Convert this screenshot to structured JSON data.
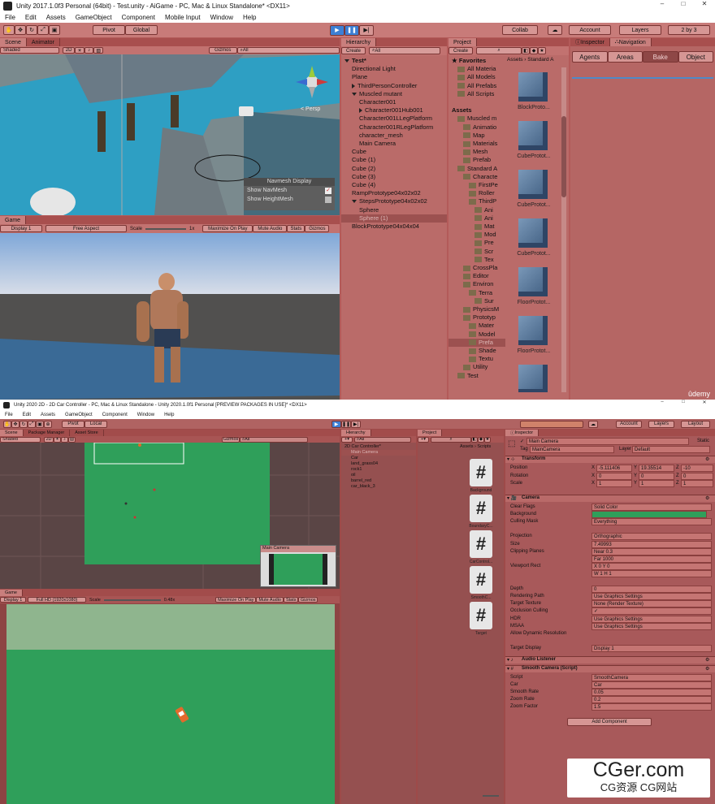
{
  "top": {
    "title": "Unity 2017.1.0f3 Personal (64bit) - Test.unity - AiGame - PC, Mac & Linux Standalone* <DX11>",
    "menu": [
      "File",
      "Edit",
      "Assets",
      "GameObject",
      "Component",
      "Mobile Input",
      "Window",
      "Help"
    ],
    "toolbar": {
      "pivot": "Pivot",
      "global": "Global",
      "collab": "Collab",
      "account": "Account",
      "layers": "Layers",
      "layout": "2 by 3"
    },
    "scene": {
      "tab": "Scene",
      "tab2": "Animator",
      "shading": "Shaded",
      "mode2d": "2D",
      "gizmos": "Gizmos",
      "search": "All",
      "persp": "< Persp",
      "navmesh": {
        "title": "Navmesh Display",
        "show_navmesh": "Show NavMesh",
        "show_height": "Show HeightMesh"
      }
    },
    "game": {
      "tab": "Game",
      "display": "Display 1",
      "aspect": "Free Aspect",
      "scale_label": "Scale",
      "scale_value": "1x",
      "maximize": "Maximize On Play",
      "mute": "Mute Audio",
      "stats": "Stats",
      "gizmos": "Gizmos"
    },
    "hierarchy": {
      "tab": "Hierarchy",
      "create": "Create",
      "search": "All",
      "items": [
        {
          "label": "Test*",
          "indent": 0,
          "arrow": "down",
          "bold": true
        },
        {
          "label": "Directional Light",
          "indent": 1
        },
        {
          "label": "Plane",
          "indent": 1
        },
        {
          "label": "ThirdPersonController",
          "indent": 1,
          "arrow": "right"
        },
        {
          "label": "Muscled mutant",
          "indent": 1,
          "arrow": "down"
        },
        {
          "label": "Character001",
          "indent": 2
        },
        {
          "label": "Character001Hub001",
          "indent": 2,
          "arrow": "right"
        },
        {
          "label": "Character001LLegPlatform",
          "indent": 2
        },
        {
          "label": "Character001RLegPlatform",
          "indent": 2
        },
        {
          "label": "character_mesh",
          "indent": 2
        },
        {
          "label": "Main Camera",
          "indent": 2
        },
        {
          "label": "Cube",
          "indent": 1
        },
        {
          "label": "Cube (1)",
          "indent": 1
        },
        {
          "label": "Cube (2)",
          "indent": 1
        },
        {
          "label": "Cube (3)",
          "indent": 1
        },
        {
          "label": "Cube (4)",
          "indent": 1
        },
        {
          "label": "RampPrototype04x02x02",
          "indent": 1
        },
        {
          "label": "StepsPrototype04x02x02",
          "indent": 1,
          "arrow": "down"
        },
        {
          "label": "Sphere",
          "indent": 2
        },
        {
          "label": "Sphere (1)",
          "indent": 2,
          "selected": true
        },
        {
          "label": "BlockPrototype04x04x04",
          "indent": 1
        }
      ]
    },
    "project": {
      "tab": "Project",
      "create": "Create",
      "breadcrumb": "Assets › Standard A",
      "tree": [
        {
          "label": "Favorites",
          "indent": 0,
          "bold": true,
          "star": true
        },
        {
          "label": "All Materia",
          "indent": 1
        },
        {
          "label": "All Models",
          "indent": 1
        },
        {
          "label": "All Prefabs",
          "indent": 1
        },
        {
          "label": "All Scripts",
          "indent": 1
        },
        {
          "label": "",
          "indent": 0
        },
        {
          "label": "Assets",
          "indent": 0,
          "bold": true
        },
        {
          "label": "Muscled m",
          "indent": 1
        },
        {
          "label": "Animatio",
          "indent": 2
        },
        {
          "label": "Map",
          "indent": 2
        },
        {
          "label": "Materials",
          "indent": 2
        },
        {
          "label": "Mesh",
          "indent": 2
        },
        {
          "label": "Prefab",
          "indent": 2
        },
        {
          "label": "Standard A",
          "indent": 1
        },
        {
          "label": "Characte",
          "indent": 2
        },
        {
          "label": "FirstPe",
          "indent": 3
        },
        {
          "label": "Roller",
          "indent": 3
        },
        {
          "label": "ThirdP",
          "indent": 3
        },
        {
          "label": "Ani",
          "indent": 4
        },
        {
          "label": "Ani",
          "indent": 4
        },
        {
          "label": "Mat",
          "indent": 4
        },
        {
          "label": "Mod",
          "indent": 4
        },
        {
          "label": "Pre",
          "indent": 4
        },
        {
          "label": "Scr",
          "indent": 4
        },
        {
          "label": "Tex",
          "indent": 4
        },
        {
          "label": "CrossPla",
          "indent": 2
        },
        {
          "label": "Editor",
          "indent": 2
        },
        {
          "label": "Environ",
          "indent": 2
        },
        {
          "label": "Terra",
          "indent": 3
        },
        {
          "label": "Sur",
          "indent": 4
        },
        {
          "label": "PhysicsM",
          "indent": 2
        },
        {
          "label": "Prototyp",
          "indent": 2
        },
        {
          "label": "Mater",
          "indent": 3
        },
        {
          "label": "Model",
          "indent": 3
        },
        {
          "label": "Prefa",
          "indent": 3,
          "selected": true
        },
        {
          "label": "Shade",
          "indent": 3
        },
        {
          "label": "Textu",
          "indent": 3
        },
        {
          "label": "Utility",
          "indent": 2
        },
        {
          "label": "Test",
          "indent": 1
        }
      ],
      "assets": [
        "BlockProto...",
        "CubeProtot...",
        "CubeProtot...",
        "CubeProtot...",
        "FloorProtot...",
        "FloorProtot...",
        ""
      ]
    },
    "inspector": {
      "tab": "Inspector",
      "tab2": "Navigation",
      "buttons": [
        "Agents",
        "Areas",
        "Bake",
        "Object"
      ],
      "active": "Bake"
    },
    "watermark": "ûdemy"
  },
  "bottom": {
    "title": "Unity 2020 2D - 2D Car Controller - PC, Mac & Linux Standalone - Unity 2020.1.0f1 Personal [PREVIEW PACKAGES IN USE]* <DX11>",
    "menu": [
      "File",
      "Edit",
      "Assets",
      "GameObject",
      "Component",
      "Window",
      "Help"
    ],
    "toolbar": {
      "pivot": "Pivot",
      "local": "Local",
      "account": "Account",
      "layers": "Layers",
      "layout": "Layout"
    },
    "scene": {
      "tabs": [
        "Scene",
        "Package Manager",
        "Asset Store"
      ],
      "shading": "Shaded",
      "mode2d": "2D",
      "gizmos": "Gizmos",
      "search": "All",
      "cam_preview": "Main Camera"
    },
    "game": {
      "tab": "Game",
      "display": "Display 1",
      "resolution": "Full HD (1920x1080)",
      "scale_label": "Scale",
      "scale_value": "0.48x",
      "maximize": "Maximize On Play",
      "mute": "Mute Audio",
      "stats": "Stats",
      "gizmos": "Gizmos"
    },
    "hierarchy": {
      "tab": "Hierarchy",
      "search": "All",
      "items": [
        {
          "label": "2D Car Controller*",
          "indent": 0
        },
        {
          "label": "Main Camera",
          "indent": 1,
          "selected": true
        },
        {
          "label": "Car",
          "indent": 1
        },
        {
          "label": "land_grass04",
          "indent": 1
        },
        {
          "label": "rock1",
          "indent": 1
        },
        {
          "label": "oil",
          "indent": 1
        },
        {
          "label": "barrel_red",
          "indent": 1
        },
        {
          "label": "car_black_3",
          "indent": 1
        }
      ]
    },
    "project": {
      "tab": "Project",
      "breadcrumb": "Assets › Scripts",
      "tree": [
        {
          "label": "Favorites",
          "indent": 0,
          "bold": true
        },
        {
          "label": "All Materials",
          "indent": 1
        },
        {
          "label": "All Models",
          "indent": 1
        },
        {
          "label": "All Prefabs",
          "indent": 1
        },
        {
          "label": "All Scripts",
          "indent": 1
        },
        {
          "label": "",
          "indent": 0
        },
        {
          "label": "Assets",
          "indent": 0,
          "bold": true
        },
        {
          "label": "Animation",
          "indent": 1
        },
        {
          "label": "Prefab",
          "indent": 1
        },
        {
          "label": "Scenes",
          "indent": 1
        },
        {
          "label": "Scripts Tex",
          "indent": 1
        },
        {
          "label": "Scripts",
          "indent": 1,
          "selected": true
        },
        {
          "label": "Sprites",
          "indent": 1
        },
        {
          "label": "Packages",
          "indent": 0,
          "bold": true
        }
      ],
      "assets": [
        "Background",
        "BoundaryC...",
        "CarControl...",
        "SmoothC...",
        "Target"
      ]
    },
    "inspector": {
      "tab": "Inspector",
      "object": "Main Camera",
      "static": "Static",
      "tag_label": "Tag",
      "tag": "MainCamera",
      "layer_label": "Layer",
      "layer": "Default",
      "transform": {
        "title": "Transform",
        "rows": [
          {
            "label": "Position",
            "x": "-5.111406",
            "y": "19.35514",
            "z": "-10"
          },
          {
            "label": "Rotation",
            "x": "0",
            "y": "0",
            "z": "0"
          },
          {
            "label": "Scale",
            "x": "1",
            "y": "1",
            "z": "1"
          }
        ]
      },
      "camera": {
        "title": "Camera",
        "rows": [
          {
            "label": "Clear Flags",
            "value": "Solid Color"
          },
          {
            "label": "Background",
            "value": ""
          },
          {
            "label": "Culling Mask",
            "value": "Everything"
          },
          {
            "label": "",
            "value": ""
          },
          {
            "label": "Projection",
            "value": "Orthographic"
          },
          {
            "label": "Size",
            "value": "7.49993"
          },
          {
            "label": "Clipping Planes",
            "value": "Near  0.3"
          },
          {
            "label": "",
            "value": "Far   1000"
          },
          {
            "label": "Viewport Rect",
            "value": "X 0          Y 0"
          },
          {
            "label": "",
            "value": "W 1          H 1"
          },
          {
            "label": "",
            "value": ""
          },
          {
            "label": "Depth",
            "value": "0"
          },
          {
            "label": "Rendering Path",
            "value": "Use Graphics Settings"
          },
          {
            "label": "Target Texture",
            "value": "None (Render Texture)"
          },
          {
            "label": "Occlusion Culling",
            "value": "✓"
          },
          {
            "label": "HDR",
            "value": "Use Graphics Settings"
          },
          {
            "label": "MSAA",
            "value": "Use Graphics Settings"
          },
          {
            "label": "Allow Dynamic Resolution",
            "value": ""
          },
          {
            "label": "",
            "value": ""
          },
          {
            "label": "Target Display",
            "value": "Display 1"
          }
        ]
      },
      "audio": "Audio Listener",
      "smooth": {
        "title": "Smooth Camera (Script)",
        "rows": [
          {
            "label": "Script",
            "value": "SmoothCamera"
          },
          {
            "label": "Car",
            "value": "Car"
          },
          {
            "label": "Smooth Rate",
            "value": "0.05"
          },
          {
            "label": "Zoom Rate",
            "value": "0.2"
          },
          {
            "label": "Zoom Factor",
            "value": "1.5"
          }
        ]
      },
      "add_component": "Add Component"
    },
    "watermark": {
      "main": "CGer.com",
      "sub": "CG资源 CG网站"
    }
  },
  "colors": {
    "tint": "#b35a59",
    "grass": "#2f9f5a",
    "sky": "#c9d5e4"
  }
}
